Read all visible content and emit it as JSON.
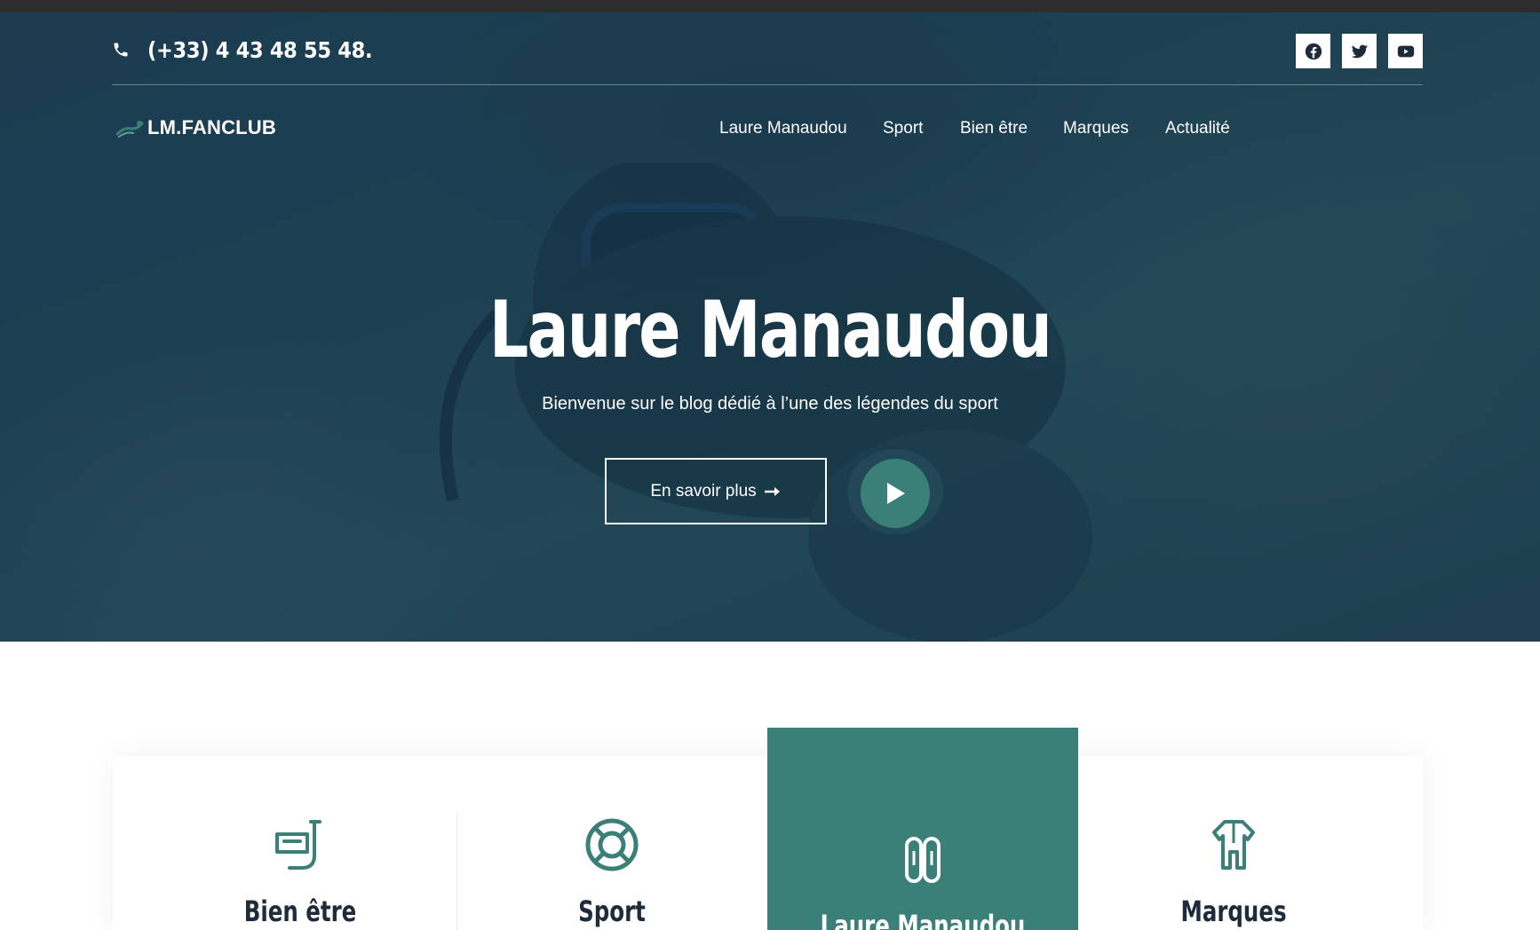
{
  "topbar": {
    "phone_icon": "phone-icon",
    "phone": "(+33) 4 43 48 55 48.",
    "social": [
      "facebook-icon",
      "twitter-icon",
      "youtube-icon"
    ]
  },
  "logo": {
    "text": "LM.FANCLUB",
    "icon": "swimmer-icon"
  },
  "nav": {
    "items": [
      {
        "label": "Laure Manaudou"
      },
      {
        "label": "Sport"
      },
      {
        "label": "Bien être"
      },
      {
        "label": "Marques"
      },
      {
        "label": "Actualité"
      }
    ]
  },
  "hero": {
    "title": "Laure Manaudou",
    "subtitle": "Bienvenue sur le blog dédié à l’une des légendes du sport",
    "button_label": "En savoir plus",
    "button_icon": "arrow-right-icon",
    "play_icon": "play-icon"
  },
  "cards": [
    {
      "title": "Bien être",
      "icon": "snorkel-mask-icon"
    },
    {
      "title": "Sport",
      "icon": "lifebuoy-icon"
    },
    {
      "title": "Laure Manaudou",
      "icon": "diving-tank-icon",
      "active": true
    },
    {
      "title": "Marques",
      "icon": "wetsuit-icon"
    }
  ],
  "colors": {
    "accent": "#3a8079",
    "hero_overlay": "#1f4156",
    "heading": "#1d2b3a",
    "white": "#ffffff"
  }
}
